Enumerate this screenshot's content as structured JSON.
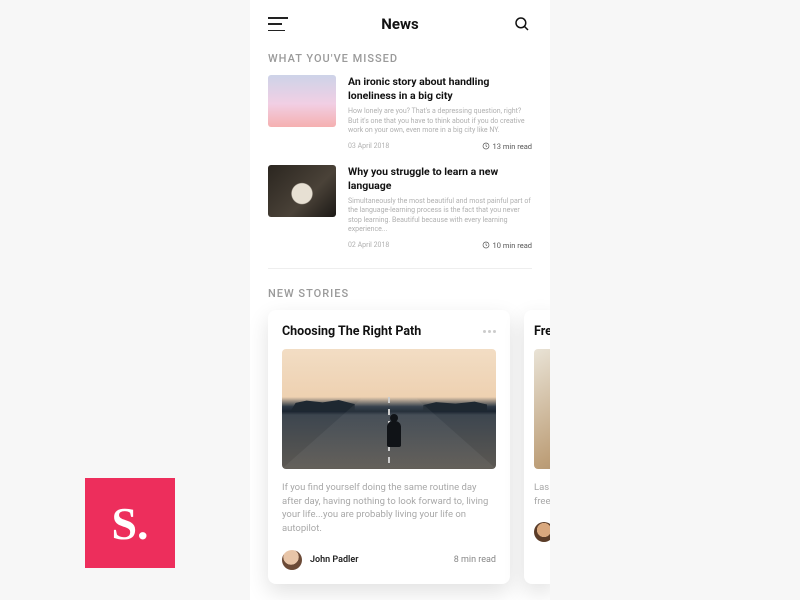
{
  "header": {
    "title": "News"
  },
  "sections": {
    "missed_title": "WHAT YOU'VE MISSED",
    "new_stories_title": "NEW STORIES"
  },
  "missed": [
    {
      "title": "An ironic story about handling loneliness in a big city",
      "excerpt": "How lonely are you? That's a depressing question, right? But it's one that you have to think about if you do creative work on your own, even more in a big city like NY.",
      "date": "03 April 2018",
      "read_time": "13 min read"
    },
    {
      "title": "Why you struggle to learn a new language",
      "excerpt": "Simultaneously the most beautiful and most painful part of the language-learning process is the fact that you never stop learning. Beautiful because with every learning experience...",
      "date": "02 April 2018",
      "read_time": "10 min read"
    }
  ],
  "stories": [
    {
      "title": "Choosing The Right Path",
      "excerpt": "If you find yourself doing the same routine day after day, having nothing to look forward to, living your life...you are probably living your life on autopilot.",
      "author": "John Padler",
      "read_time": "8 min read"
    },
    {
      "title_fragment": "Fre",
      "excerpt_fragment": "Las\nfree"
    }
  ],
  "logo": {
    "text": "S."
  }
}
